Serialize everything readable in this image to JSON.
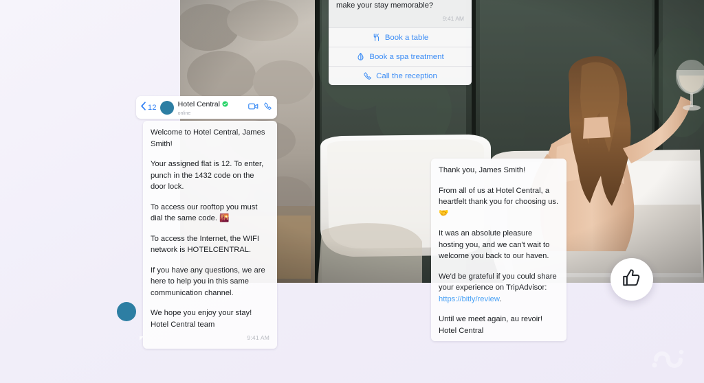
{
  "theme": {
    "background": "#f2f0fa",
    "accent_blue": "#3b8cf5",
    "avatar_teal": "#2d7ea3",
    "verified_green": "#25d366",
    "link_blue": "#47a0f5",
    "bubble_bg": "#fcfcfd",
    "timestamp_gray": "#b7bac0"
  },
  "chat_header": {
    "back_count": "12",
    "contact_name": "Hotel Central",
    "status": "online",
    "verified": true,
    "icons": {
      "back": "chevron-left-icon",
      "video": "video-camera-icon",
      "call": "phone-icon",
      "verified": "verified-badge-icon"
    }
  },
  "messages": {
    "welcome": {
      "paragraphs": [
        "Welcome to Hotel Central, James Smith!",
        "Your assigned flat is 12. To enter, punch in the 1432 code on the door lock.",
        "To access our rooftop you must dial the same code.",
        "To access the Internet, the WIFI network is HOTELCENTRAL.",
        "If you have any questions, we are here to help you in this same communication channel.",
        "We hope you enjoy your stay!\nHotel Central team"
      ],
      "emoji_rooftop": "🌇",
      "timestamp": "9:41 AM"
    },
    "thanks": {
      "greeting": "Thank you, James Smith!",
      "para_1": "From all of us at Hotel Central, a heartfelt thank you for choosing us.",
      "emoji_1": "🤝",
      "para_2": "It was an absolute pleasure hosting you, and we can't wait to welcome you back to our haven.",
      "para_3_prefix": "We'd be grateful if you could share your experience on TripAdvisor: ",
      "link_text": "https://bitly/review",
      "para_3_suffix": ".",
      "para_4": "Until we meet again, au revoir!\nHotel Central"
    }
  },
  "quick_reply": {
    "question": "Is everything okay with your stay? Is there anything else we can do to make your stay memorable?",
    "timestamp": "9:41 AM",
    "actions": [
      {
        "label": "Book a table",
        "icon": "fork-knife-icon"
      },
      {
        "label": "Book a spa treatment",
        "icon": "water-drop-icon"
      },
      {
        "label": "Call the reception",
        "icon": "phone-icon"
      }
    ]
  },
  "floating": {
    "thumbs_up_icon": "thumbs-up-icon",
    "watermark_icon": "brand-watermark-icon"
  }
}
